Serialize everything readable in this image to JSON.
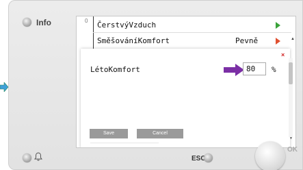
{
  "device": {
    "info_label": "Info",
    "esc_label": "ESC",
    "ok_label": "OK"
  },
  "menu": {
    "number": "0",
    "rows": [
      {
        "label": "ČerstvýVzduch",
        "value": "",
        "arrow_color": "#3aa23a"
      },
      {
        "label": "SměšováníKomfort",
        "value": "Pevně",
        "arrow_color": "#e05030"
      }
    ]
  },
  "dialog": {
    "parameter_label": "LétoKomfort",
    "value": "80",
    "unit": "%",
    "save_label": "Save",
    "cancel_label": "Cancel",
    "close_glyph": "×"
  },
  "colors": {
    "pointer_arrow": "#7b2fa5",
    "side_arrow": "#3fa0d8",
    "close": "#d02020"
  },
  "icons": [
    "left-nav-arrow-icon",
    "close-icon",
    "pointer-arrow-icon",
    "bell-icon",
    "row-arrow-icon"
  ]
}
